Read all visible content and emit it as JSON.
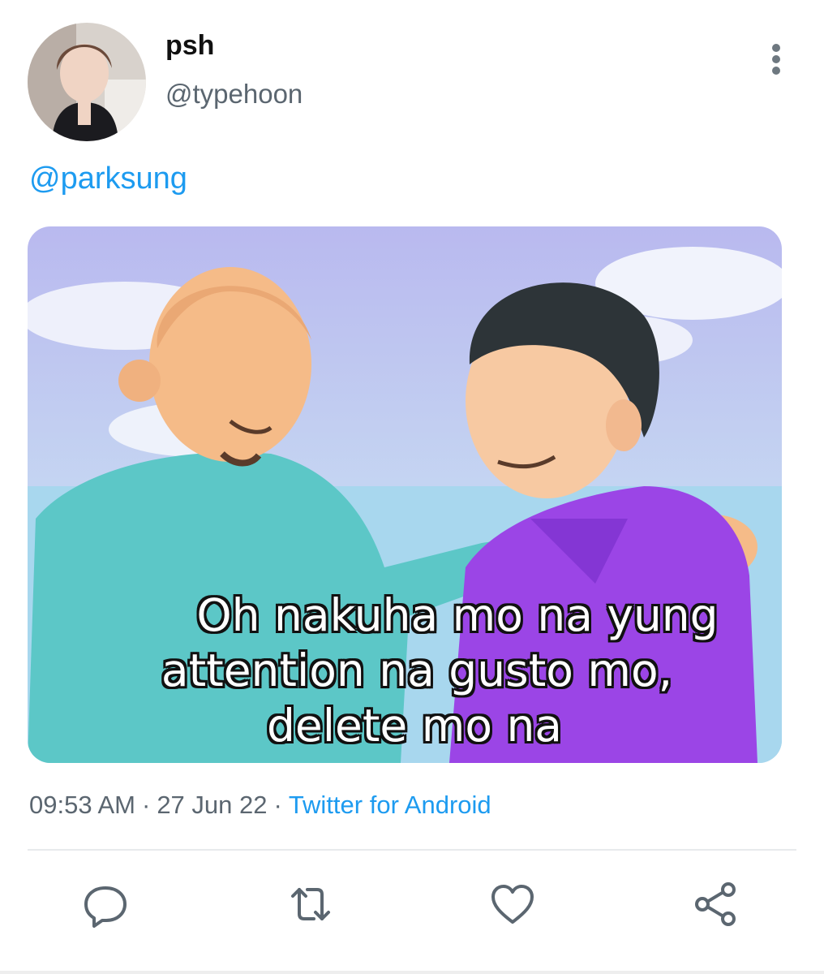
{
  "author": {
    "display_name": "psh",
    "handle": "@typehoon"
  },
  "tweet": {
    "mention": "@parksung",
    "media_caption": [
      "Oh nakuha mo na yung",
      "attention na gusto mo,",
      "delete mo na"
    ],
    "time": "09:53 AM",
    "date": "27 Jun 22",
    "source": "Twitter for Android",
    "separator": "·"
  },
  "icons": {
    "more": "more-vertical-icon",
    "reply": "reply-icon",
    "retweet": "retweet-icon",
    "like": "heart-icon",
    "share": "share-icon"
  },
  "colors": {
    "accent": "#1d9bf0",
    "secondary_text": "#5b6670",
    "icon": "#5b6670"
  }
}
